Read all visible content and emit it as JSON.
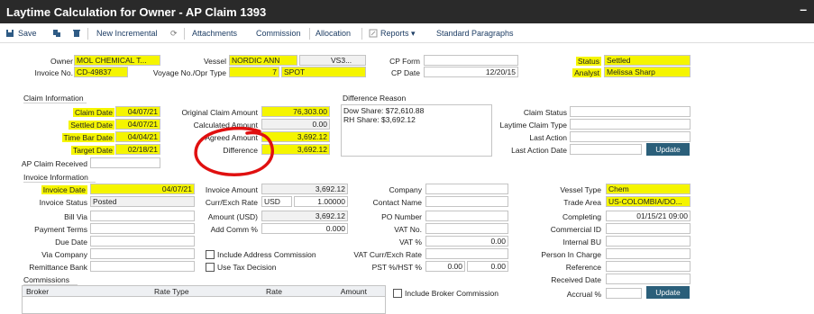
{
  "window": {
    "title": "Laytime Calculation for Owner - AP Claim 1393",
    "minimize": "–"
  },
  "toolbar": {
    "save": "Save",
    "new_incremental": "New Incremental",
    "attachments": "Attachments",
    "commission": "Commission",
    "allocation": "Allocation",
    "reports": "Reports ▾",
    "standard_paragraphs": "Standard Paragraphs"
  },
  "header": {
    "owner_label": "Owner",
    "owner": "MOL CHEMICAL T...",
    "invoice_no_label": "Invoice No.",
    "invoice_no": "CD-49837",
    "vessel_label": "Vessel",
    "vessel": "NORDIC ANN",
    "vessel_code": "VS3...",
    "voyage_label": "Voyage No./Opr Type",
    "voyage_no": "7",
    "opr_type": "SPOT",
    "cp_form_label": "CP Form",
    "cp_form": "",
    "cp_date_label": "CP Date",
    "cp_date": "12/20/15",
    "status_label": "Status",
    "status": "Settled",
    "analyst_label": "Analyst",
    "analyst": "Melissa Sharp"
  },
  "claim_info": {
    "section": "Claim Information",
    "claim_date_label": "Claim Date",
    "claim_date": "04/07/21",
    "settled_date_label": "Settled Date",
    "settled_date": "04/07/21",
    "time_bar_date_label": "Time Bar Date",
    "time_bar_date": "04/04/21",
    "target_date_label": "Target Date",
    "target_date": "02/18/21",
    "ap_claim_received_label": "AP Claim Received",
    "ap_claim_received": "",
    "original_amount_label": "Original Claim Amount",
    "original_amount": "76,303.00",
    "calculated_amount_label": "Calculated Amount",
    "calculated_amount": "0.00",
    "agreed_amount_label": "Agreed Amount",
    "agreed_amount": "3,692.12",
    "difference_label": "Difference",
    "difference": "3,692.12",
    "difference_reason_label": "Difference Reason",
    "difference_reason_line1": "Dow Share: $72,610.88",
    "difference_reason_line2": "RH Share: $3,692.12",
    "claim_status_label": "Claim Status",
    "claim_status": "",
    "laytime_claim_type_label": "Laytime Claim Type",
    "laytime_claim_type": "",
    "last_action_label": "Last Action",
    "last_action": "",
    "last_action_date_label": "Last Action Date",
    "last_action_date": "",
    "update_button": "Update"
  },
  "invoice_info": {
    "section": "Invoice Information",
    "invoice_date_label": "Invoice Date",
    "invoice_date": "04/07/21",
    "invoice_status_label": "Invoice Status",
    "invoice_status": "Posted",
    "bill_via_label": "Bill Via",
    "bill_via": "",
    "payment_terms_label": "Payment Terms",
    "payment_terms": "",
    "due_date_label": "Due Date",
    "due_date": "",
    "via_company_label": "Via Company",
    "via_company": "",
    "remittance_bank_label": "Remittance Bank",
    "remittance_bank": "",
    "invoice_amount_label": "Invoice Amount",
    "invoice_amount": "3,692.12",
    "curr_label": "Curr/Exch Rate",
    "currency": "USD",
    "exch_rate": "1.00000",
    "amount_usd_label": "Amount (USD)",
    "amount_usd": "3,692.12",
    "add_comm_label": "Add Comm %",
    "add_comm": "0.000",
    "include_address_commission": "Include Address Commission",
    "use_tax_decision": "Use Tax Decision",
    "company_label": "Company",
    "company": "",
    "contact_name_label": "Contact Name",
    "contact_name": "",
    "po_number_label": "PO Number",
    "po_number": "",
    "vat_no_label": "VAT No.",
    "vat_no": "",
    "vat_pct_label": "VAT %",
    "vat_pct": "0.00",
    "vat_curr_label": "VAT Curr/Exch Rate",
    "vat_curr": "",
    "pst_label": "PST %/HST %",
    "pst": "0.00",
    "hst": "0.00",
    "vessel_type_label": "Vessel Type",
    "vessel_type": "Chem",
    "trade_area_label": "Trade Area",
    "trade_area": "US-COLOMBIA/DO...",
    "completing_label": "Completing",
    "completing": "01/15/21 09:00",
    "commercial_id_label": "Commercial ID",
    "commercial_id": "",
    "internal_bu_label": "Internal BU",
    "internal_bu": "",
    "person_in_charge_label": "Person In Charge",
    "person_in_charge": "",
    "reference_label": "Reference",
    "reference": "",
    "received_date_label": "Received Date",
    "received_date": "",
    "accrual_label": "Accrual %",
    "accrual": "",
    "update_button": "Update"
  },
  "commissions": {
    "section": "Commissions",
    "columns": [
      "Broker",
      "Rate Type",
      "Rate",
      "Amount"
    ],
    "include_broker_commission": "Include Broker Commission"
  },
  "colors": {
    "titlebar": "#2a2a2a",
    "highlight": "#f5f500",
    "button": "#2b5f7a",
    "annotation": "#e01010"
  }
}
